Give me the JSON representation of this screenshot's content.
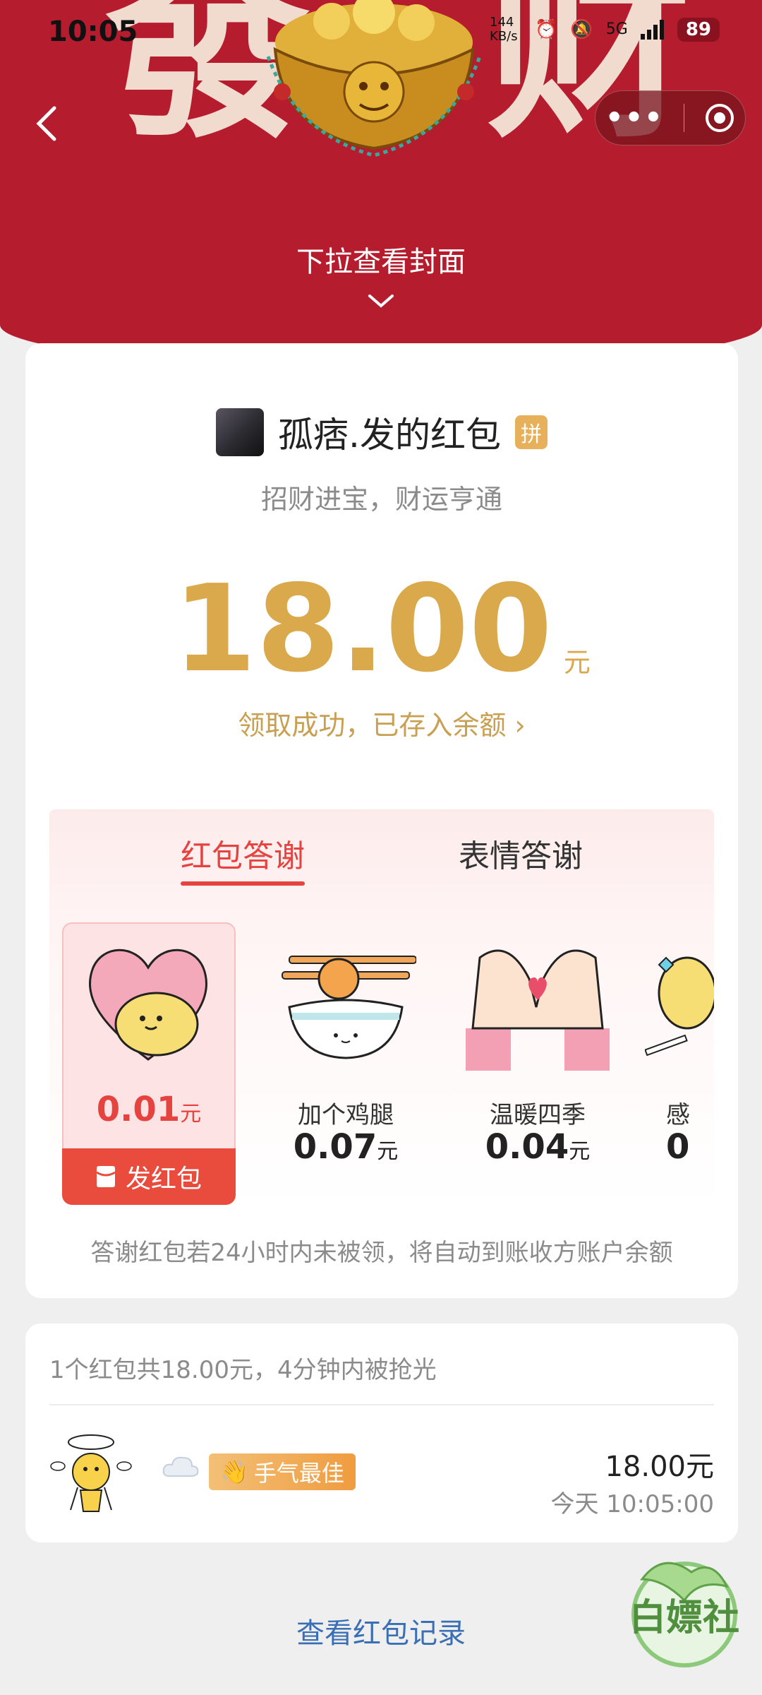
{
  "status_bar": {
    "time": "10:05",
    "net_speed": "144 KB/s",
    "network": "5G",
    "battery": "89"
  },
  "header": {
    "cover_chars": [
      "發",
      "财"
    ],
    "pull_hint": "下拉查看封面"
  },
  "sender": {
    "name": "孤痞.发的红包",
    "badge": "拼",
    "greeting": "招财进宝，财运亨通"
  },
  "amount": {
    "value": "18.00",
    "unit": "元",
    "status": "领取成功，已存入余额",
    "status_chevron": "›"
  },
  "thanks": {
    "tabs": [
      {
        "label": "红包答谢",
        "active": true
      },
      {
        "label": "表情答谢",
        "active": false
      }
    ],
    "items": [
      {
        "icon": "heart-hug-icon",
        "label": "",
        "price": "0.01",
        "unit": "元",
        "selected": true,
        "button": "发红包"
      },
      {
        "icon": "rice-bowl-icon",
        "label": "加个鸡腿",
        "price": "0.07",
        "unit": "元"
      },
      {
        "icon": "hands-heart-icon",
        "label": "温暖四季",
        "price": "0.04",
        "unit": "元"
      },
      {
        "icon": "star-wand-icon",
        "label": "感",
        "price": "0",
        "unit": ""
      }
    ],
    "note": "答谢红包若24小时内未被领，将自动到账收方账户余额"
  },
  "records": {
    "summary": "1个红包共18.00元，4分钟内被抢光",
    "entries": [
      {
        "badge": "手气最佳",
        "amount": "18.00元",
        "time": "今天 10:05:00"
      }
    ]
  },
  "footer": {
    "link": "查看红包记录",
    "watermark": "白嫖社"
  },
  "colors": {
    "header_red": "#b51d2e",
    "gold": "#d9a94b",
    "accent_red": "#e64340",
    "link_blue": "#3a6fb5"
  }
}
